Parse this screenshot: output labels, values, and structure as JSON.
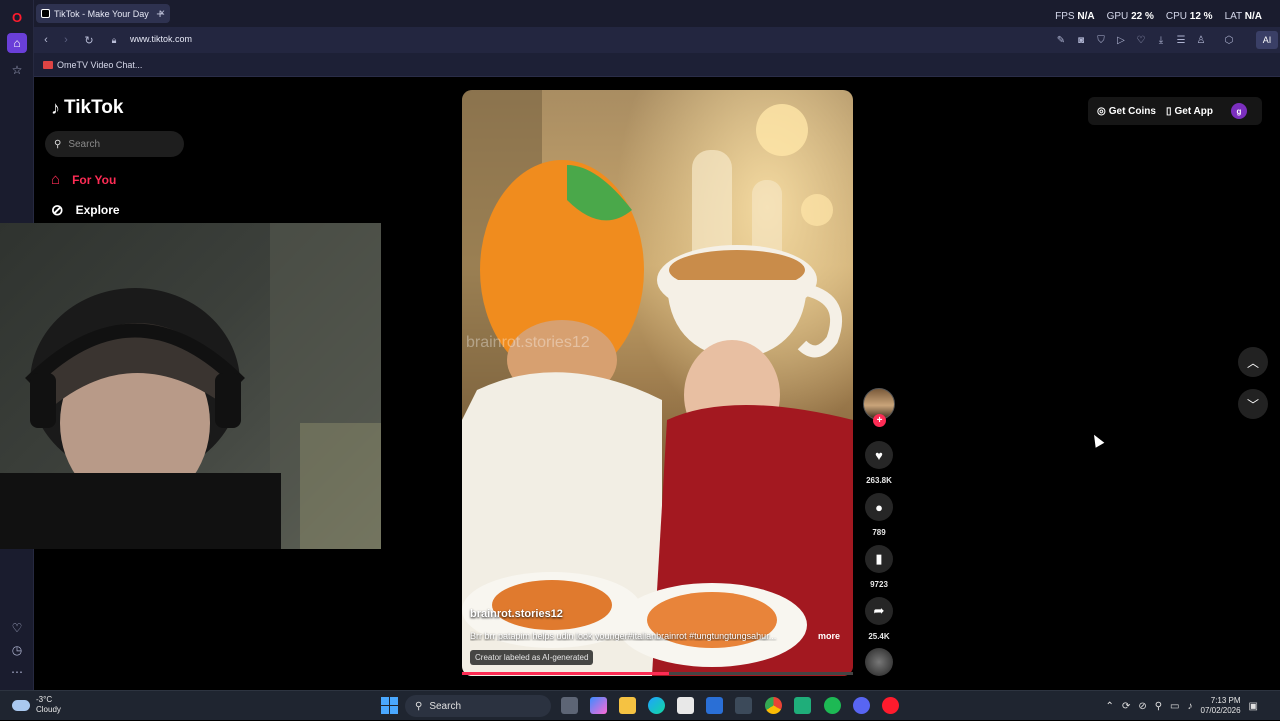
{
  "browser": {
    "tab_title": "TikTok - Make Your Day",
    "url": "www.tiktok.com",
    "bookmark": "OmeTV Video Chat...",
    "ai_label": "AI",
    "perf": [
      {
        "label": "FPS",
        "value": "N/A"
      },
      {
        "label": "GPU",
        "value": "22 %"
      },
      {
        "label": "CPU",
        "value": "12 %"
      },
      {
        "label": "LAT",
        "value": "N/A"
      }
    ]
  },
  "tiktok": {
    "brand": "TikTok",
    "search_placeholder": "Search",
    "nav": [
      {
        "label": "For You"
      },
      {
        "label": "Explore"
      }
    ],
    "get_coins": "Get Coins",
    "get_app": "Get App",
    "user_initial": "g",
    "video": {
      "watermark": "brainrot.stories12",
      "author": "brainrot.stories12",
      "caption": "Brr brr patapim helps udin look younger#italianbrainrot #tungtungtungsahur...",
      "more": "more",
      "ai_label": "Creator labeled as AI-generated",
      "progress": 0.53,
      "likes": "263.8K",
      "comments": "789",
      "saves": "9723",
      "shares": "25.4K"
    }
  },
  "taskbar": {
    "weather_temp": "-3°C",
    "weather_desc": "Cloudy",
    "search_label": "Search",
    "time": "7:13 PM",
    "date": "07/02/2026"
  },
  "colors": {
    "tiktok_red": "#fe2c55",
    "opera_dark": "#1a1c2e"
  }
}
